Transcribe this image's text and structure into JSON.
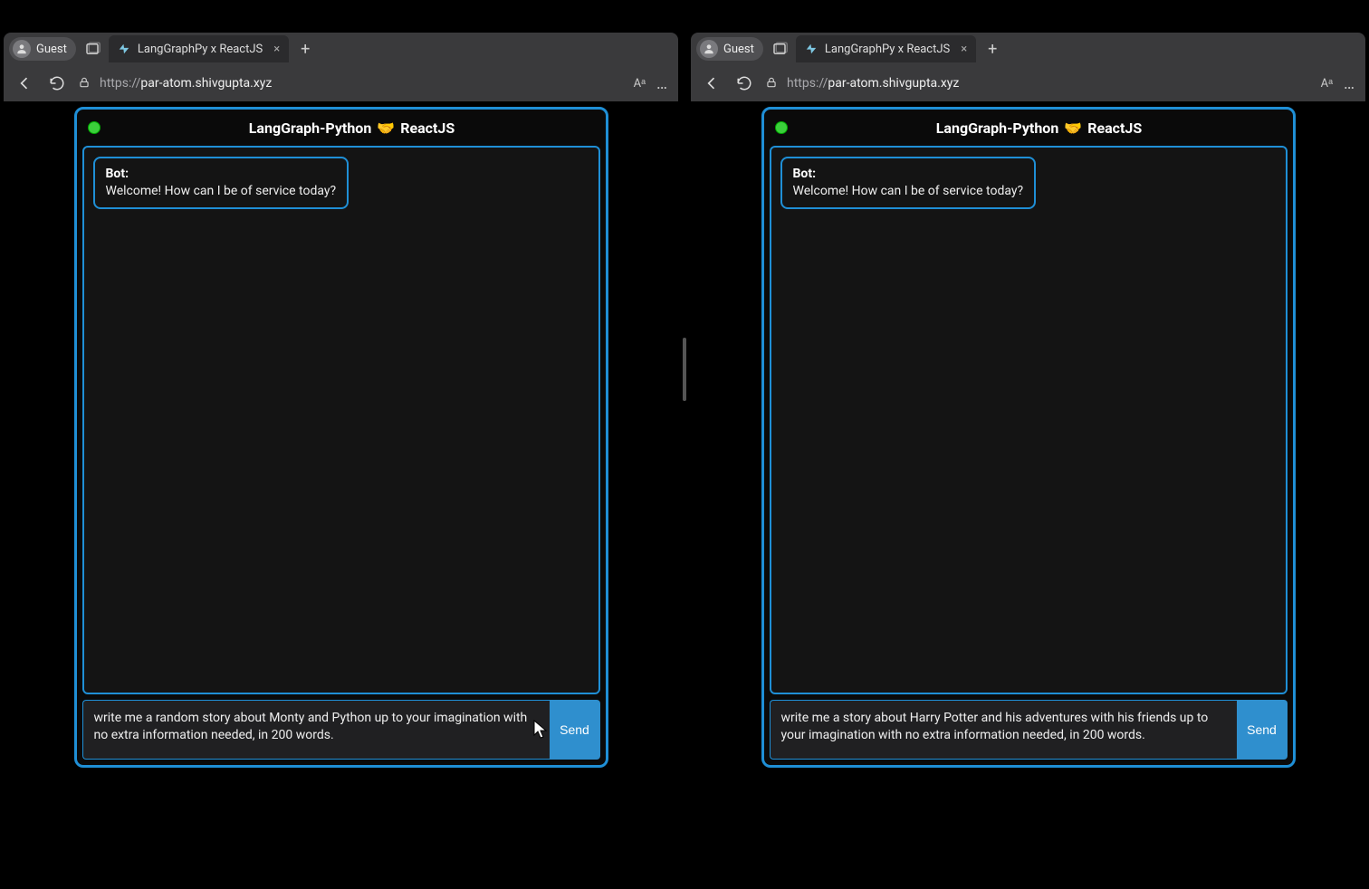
{
  "windows": [
    {
      "profile_label": "Guest",
      "tab_title": "LangGraphPy x ReactJS",
      "url_scheme": "https://",
      "url_host": "par-atom.shivgupta.xyz",
      "url_rest": "",
      "app_title_left": "LangGraph-Python",
      "app_title_right": "ReactJS",
      "status_color": "#3bcf3b",
      "bot_sender": "Bot:",
      "bot_message": "Welcome! How can I be of service today?",
      "input_value": "write me a random story about Monty and Python up to your imagination with no extra information needed, in 200 words.",
      "send_label": "Send"
    },
    {
      "profile_label": "Guest",
      "tab_title": "LangGraphPy x ReactJS",
      "url_scheme": "https://",
      "url_host": "par-atom.shivgupta.xyz",
      "url_rest": "",
      "app_title_left": "LangGraph-Python",
      "app_title_right": "ReactJS",
      "status_color": "#3bcf3b",
      "bot_sender": "Bot:",
      "bot_message": "Welcome! How can I be of service today?",
      "input_value": "write me a story about Harry Potter and his adventures with his friends up to your imagination with no extra information needed, in 200 words.",
      "send_label": "Send"
    }
  ],
  "icons": {
    "reader_label": "Aᵃ",
    "more_glyph": "…",
    "plus_glyph": "+",
    "close_glyph": "×",
    "handshake_glyph": "🤝"
  },
  "colors": {
    "accent": "#1f8fd6",
    "send_bg": "#2f8fce",
    "chrome_bg": "#3a3a3c",
    "page_bg": "#000000"
  }
}
